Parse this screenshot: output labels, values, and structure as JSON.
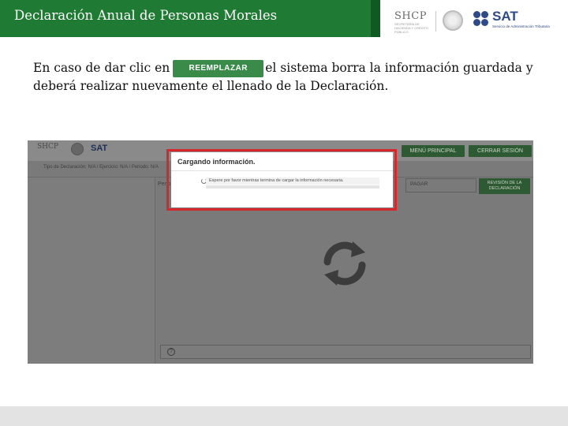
{
  "header": {
    "title": "Declaración Anual de Personas Morales",
    "logos": {
      "shcp": "SHCP",
      "shcp_sub": "SECRETARÍA DE HACIENDA Y CRÉDITO PÚBLICO",
      "sat": "SAT",
      "sat_sub": "Servicio de Administración Tributaria"
    },
    "brand_color": "#1f7a33"
  },
  "instruction": {
    "before": "En caso de dar clic en",
    "button_label": "REEMPLAZAR",
    "after": "el sistema borra la información guardada y deberá realizar nuevamente el llenado de la Declaración."
  },
  "screenshot": {
    "logos": {
      "shcp": "SHCP",
      "sat": "SAT"
    },
    "menu_button": "MENÚ PRINCIPAL",
    "logout_button": "CERRAR SESIÓN",
    "declaration_info": "Tipo de Declaración: N/A / Ejercicio: N/A / Periodo: N/A",
    "periodo_label": "Perio",
    "field_label": "PAGAR",
    "review_button": "REVISIÓN DE LA DECLARACIÓN",
    "help_icon": "?",
    "modal": {
      "title": "Cargando información.",
      "message": "Espere por favor mientras termina de cargar la información necesaria.",
      "highlight_color": "#d6282c"
    },
    "spinner_icon": "refresh-icon"
  }
}
